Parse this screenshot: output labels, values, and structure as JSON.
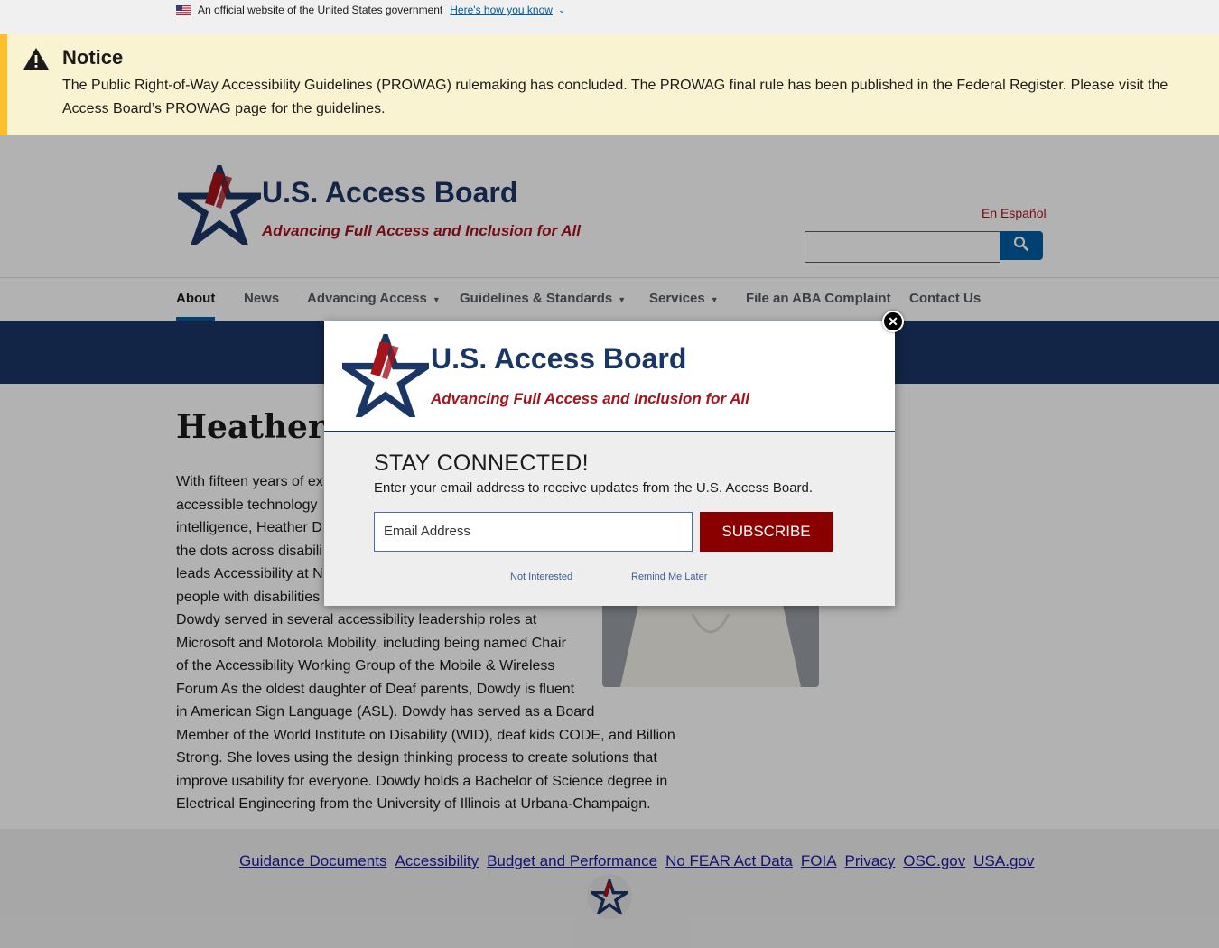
{
  "gov_banner": {
    "text": "An official website of the United States government",
    "link": "Here's how you know"
  },
  "notice": {
    "title": "Notice",
    "body": "The Public Right-of-Way Accessibility Guidelines (PROWAG) rulemaking has concluded. The PROWAG final rule has been published in the Federal Register. Please visit the Access Board’s PROWAG page for the guidelines."
  },
  "header": {
    "title": "U.S. Access Board",
    "tagline": "Advancing Full Access and Inclusion for All",
    "language_link": "En Español"
  },
  "nav": {
    "items": [
      {
        "label": "About"
      },
      {
        "label": "News"
      },
      {
        "label": "Advancing Access"
      },
      {
        "label": "Guidelines & Standards"
      },
      {
        "label": "Services"
      },
      {
        "label": "File an ABA Complaint"
      },
      {
        "label": "Contact Us"
      }
    ]
  },
  "content": {
    "heading": "Heather D",
    "bio": [
      "With fifteen years of ex",
      "accessible technology",
      "intelligence, Heather D",
      "the dots across disabili",
      "leads Accessibility at N",
      "people with disabilities",
      "Dowdy served in several accessibility leadership roles at",
      "Microsoft and Motorola Mobility, including being named Chair",
      "of the Accessibility Working Group of the Mobile & Wireless",
      "Forum As the oldest daughter of Deaf parents, Dowdy is fluent",
      "in American Sign Language (ASL). Dowdy has served as a Board",
      "Member of the World Institute on Disability (WID), deaf kids CODE, and Billion",
      "Strong. She loves using the design thinking process to create solutions that",
      "improve usability for everyone. Dowdy holds a Bachelor of Science degree in",
      "Electrical Engineering from the University of Illinois at Urbana-Champaign."
    ]
  },
  "footer": {
    "links": [
      "Guidance Documents",
      "Accessibility",
      "Budget and Performance",
      "No FEAR Act Data",
      "FOIA",
      "Privacy",
      "OSC.gov",
      "USA.gov"
    ]
  },
  "modal": {
    "title": "U.S. Access Board",
    "tagline": "Advancing Full Access and Inclusion for All",
    "heading": "STAY CONNECTED!",
    "text": "Enter your email address to receive updates from the U.S. Access Board.",
    "email_placeholder": "Email Address",
    "subscribe_label": "SUBSCRIBE",
    "not_interested": "Not Interested",
    "remind_later": "Remind Me Later"
  }
}
